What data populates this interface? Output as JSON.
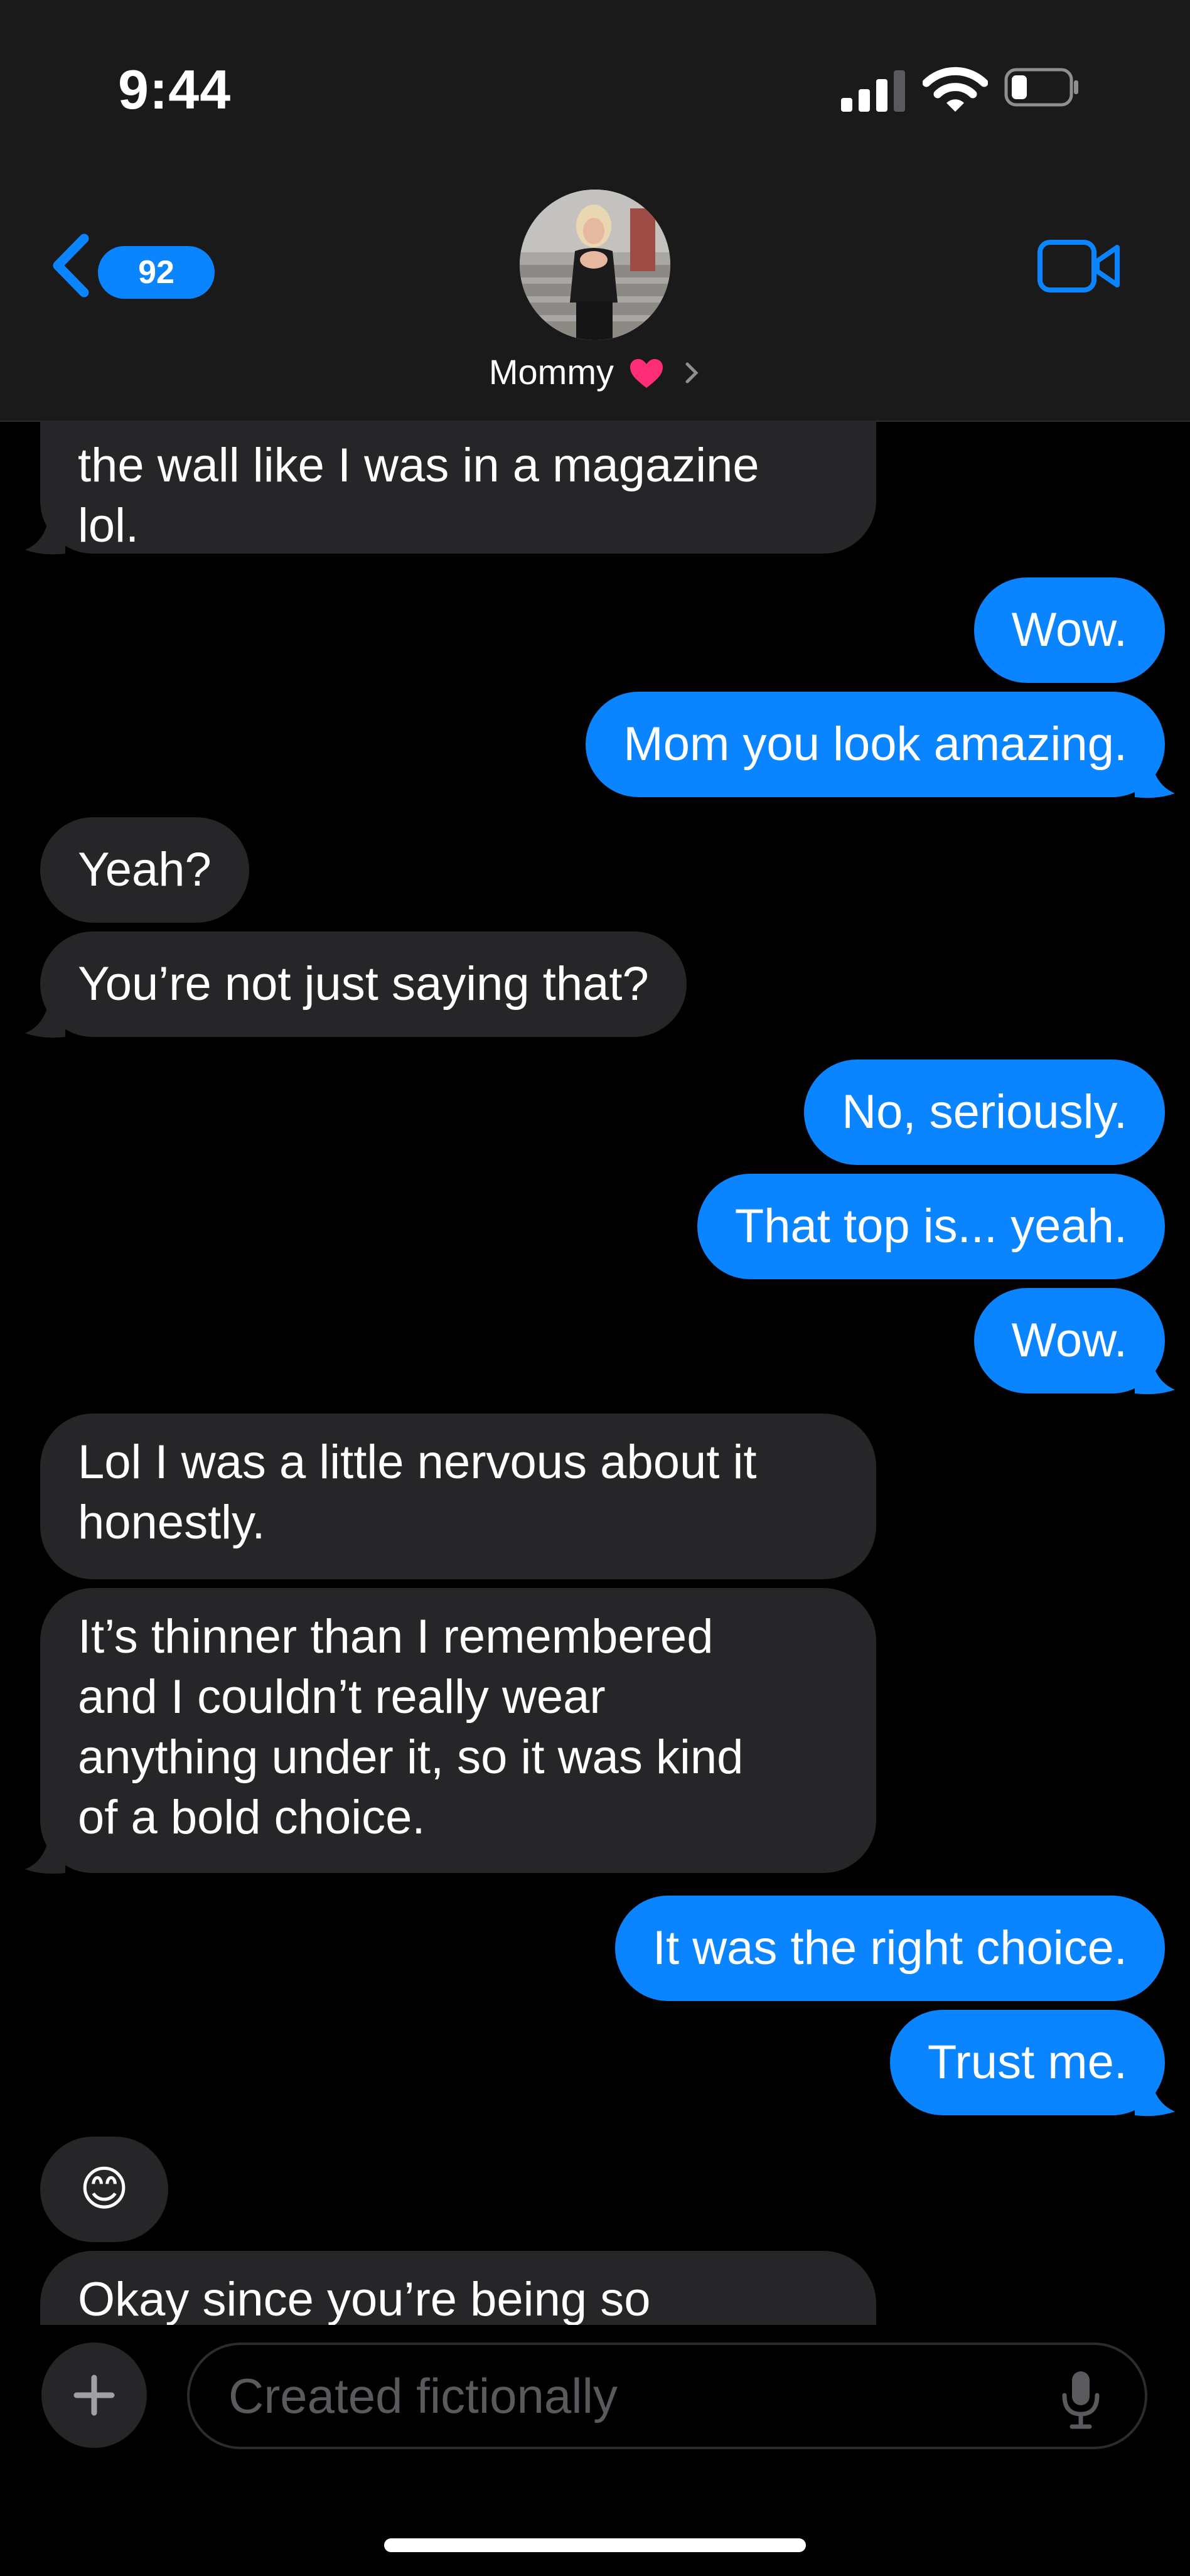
{
  "status_bar": {
    "time": "9:44"
  },
  "header": {
    "back_badge_count": "92",
    "contact_name": "Mommy"
  },
  "messages": [
    {
      "direction": "received",
      "text_lines": [
        "the wall like I was in a magazine",
        "lol."
      ]
    },
    {
      "direction": "sent",
      "text": "Wow."
    },
    {
      "direction": "sent",
      "text": "Mom you look amazing."
    },
    {
      "direction": "received",
      "text": "Yeah?"
    },
    {
      "direction": "received",
      "text": "You’re not just saying that?"
    },
    {
      "direction": "sent",
      "text": "No, seriously."
    },
    {
      "direction": "sent",
      "text": "That top is... yeah."
    },
    {
      "direction": "sent",
      "text": "Wow."
    },
    {
      "direction": "received",
      "text_lines": [
        "Lol I was a little nervous about it",
        "honestly."
      ]
    },
    {
      "direction": "received",
      "text_lines": [
        "It’s thinner than I remembered",
        "and I couldn’t really wear",
        "anything under it, so it was kind",
        "of a bold choice."
      ]
    },
    {
      "direction": "sent",
      "text": "It was the right choice."
    },
    {
      "direction": "sent",
      "text": "Trust me."
    },
    {
      "direction": "received",
      "text": "😊"
    },
    {
      "direction": "received",
      "text": "Okay since you’re being so"
    }
  ],
  "input": {
    "placeholder": "Created fictionally"
  },
  "colors": {
    "sent_bubble": "#0a84ff",
    "received_bubble": "#262628",
    "background": "#000000",
    "header": "#1a1a1a"
  }
}
